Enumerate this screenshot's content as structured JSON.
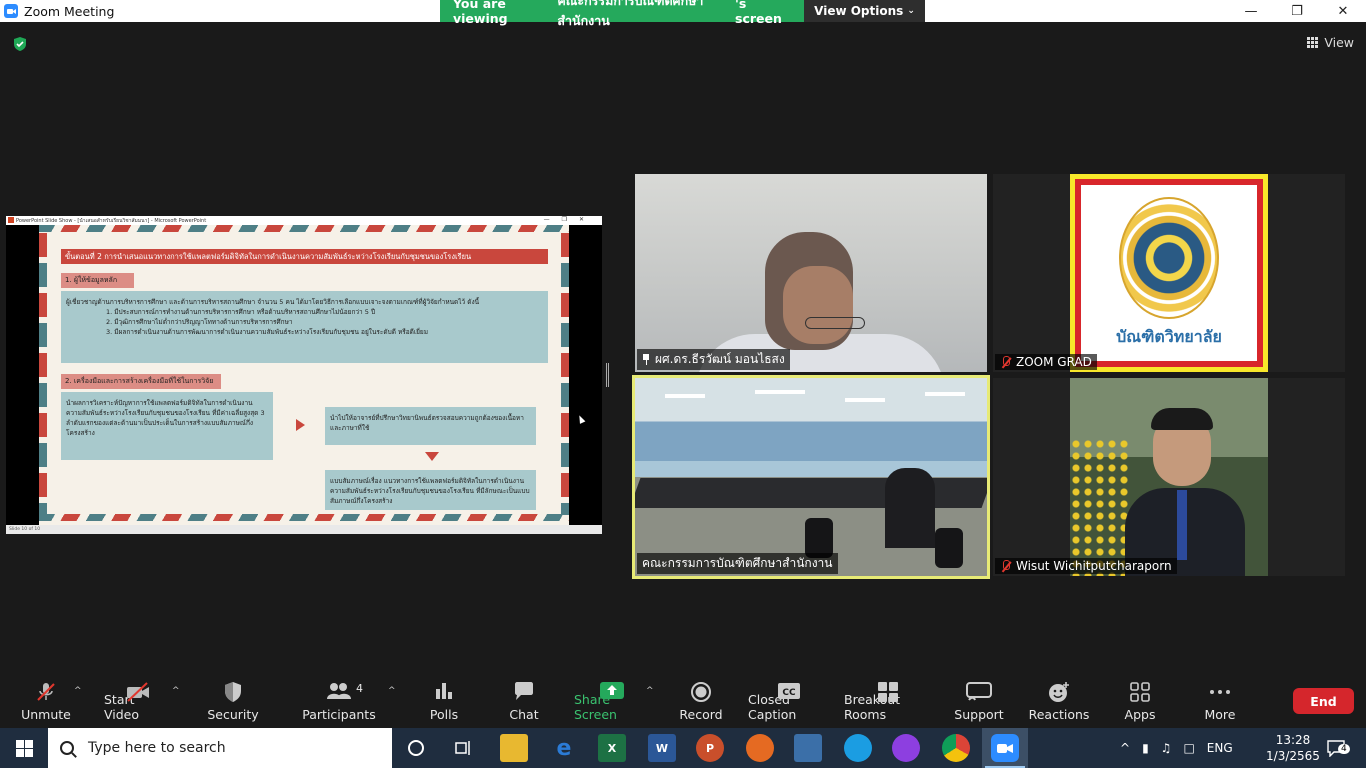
{
  "window": {
    "title": "Zoom Meeting"
  },
  "banner": {
    "viewing_prefix": "You are viewing ",
    "presenter": "คณะกรรมการบัณฑิตศึกษาสำนักงาน",
    "viewing_suffix": "'s screen",
    "view_options": "View Options"
  },
  "view_label": "View",
  "shared_screen": {
    "ppt_title": "PowerPoint Slide Show - [นำเสนอสำหรับเรียนวิชาสัมมนา] - Microsoft PowerPoint",
    "slide_status": "Slide 10 of 10",
    "slide": {
      "heading": "ขั้นตอนที่ 2  การนำเสนอแนวทางการใช้แพลตฟอร์มดิจิทัลในการดำเนินงานความสัมพันธ์ระหว่างโรงเรียนกับชุมชนของโรงเรียน",
      "section1": "1.  ผู้ให้ข้อมูลหลัก",
      "box1_lead": "ผู้เชี่ยวชาญด้านการบริหารการศึกษา และด้านการบริหารสถานศึกษา จำนวน 5 คน ได้มาโดยวิธีการเลือกแบบเจาะจงตามเกณฑ์ที่ผู้วิจัยกำหนดไว้ ดังนี้",
      "box1_items": [
        "1. มีประสบการณ์การทำงานด้านการบริหารการศึกษา หรือด้านบริหารสถานศึกษาไม่น้อยกว่า 5 ปี",
        "2. มีวุฒิการศึกษาไม่ต่ำกว่าปริญญาโททางด้านการบริหารการศึกษา",
        "3. มีผลการดำเนินงานด้านการพัฒนาการดำเนินงานความสัมพันธ์ระหว่างโรงเรียนกับชุมชน อยู่ในระดับดี หรือดีเยี่ยม"
      ],
      "section2": "2. เครื่องมือและการสร้างเครื่องมือที่ใช้ในการวิจัย",
      "box2": "นำผลการวิเคราะห์ปัญหาการใช้แพลตฟอร์มดิจิทัลในการดำเนินงานความสัมพันธ์ระหว่างโรงเรียนกับชุมชนของโรงเรียน ที่มีค่าเฉลี่ยสูงสุด 3 ลำดับแรกของแต่ละด้านมาเป็นประเด็นในการสร้างแบบสัมภาษณ์กึ่งโครงสร้าง",
      "box3": "นำไปให้อาจารย์ที่ปรึกษาวิทยานิพนธ์ตรวจสอบความถูกต้องของเนื้อหาและภาษาที่ใช้",
      "box4": "แบบสัมภาษณ์เรื่อง แนวทางการใช้แพลตฟอร์มดิจิทัลในการดำเนินงานความสัมพันธ์ระหว่างโรงเรียนกับชุมชนของโรงเรียน ที่มีลักษณะเป็นแบบสัมภาษณ์กึ่งโครงสร้าง"
    }
  },
  "participants": [
    {
      "name": "ผศ.ดร.ธีรวัฒน์ มอนไธสง",
      "pinned": true,
      "muted": false
    },
    {
      "name": "ZOOM GRAD",
      "pinned": false,
      "muted": true,
      "logo_text": "บัณฑิตวิทยาลัย"
    },
    {
      "name": "คณะกรรมการบัณฑิตศึกษาสำนักงาน",
      "pinned": false,
      "muted": false,
      "active_speaker": true
    },
    {
      "name": "Wisut Wichitputcharaporn",
      "pinned": false,
      "muted": true
    }
  ],
  "toolbar": {
    "unmute": "Unmute",
    "start_video": "Start Video",
    "security": "Security",
    "participants": "Participants",
    "participants_count": "4",
    "polls": "Polls",
    "chat": "Chat",
    "share_screen": "Share Screen",
    "record": "Record",
    "closed_caption": "Closed Caption",
    "breakout_rooms": "Breakout Rooms",
    "support": "Support",
    "reactions": "Reactions",
    "apps": "Apps",
    "more": "More",
    "end": "End"
  },
  "taskbar": {
    "search_placeholder": "Type here to search",
    "language": "ENG",
    "time": "13:28",
    "date": "1/3/2565",
    "notifications": "4"
  },
  "colors": {
    "share_green": "#25a95c",
    "end_red": "#d5262c",
    "active_speaker": "#e7ea76",
    "mute_red": "#e0372e"
  }
}
